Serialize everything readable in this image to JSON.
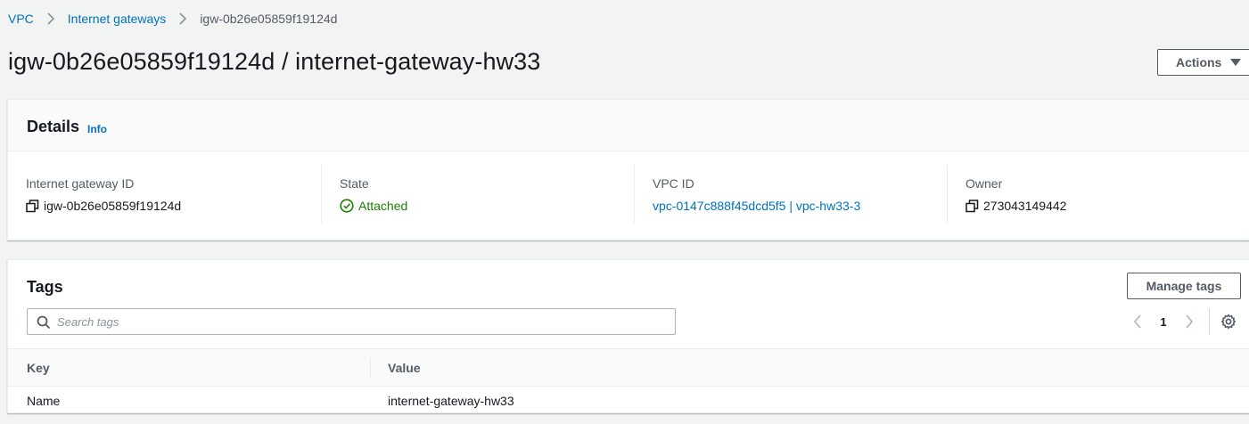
{
  "breadcrumb": {
    "items": [
      "VPC",
      "Internet gateways",
      "igw-0b26e05859f19124d"
    ]
  },
  "header": {
    "title": "igw-0b26e05859f19124d / internet-gateway-hw33",
    "actions_label": "Actions"
  },
  "details": {
    "title": "Details",
    "info_label": "Info",
    "fields": [
      {
        "label": "Internet gateway ID",
        "value": "igw-0b26e05859f19124d"
      },
      {
        "label": "State",
        "value": "Attached"
      },
      {
        "label": "VPC ID",
        "value": "vpc-0147c888f45dcd5f5 | vpc-hw33-3"
      },
      {
        "label": "Owner",
        "value": "273043149442"
      }
    ]
  },
  "tags": {
    "title": "Tags",
    "manage_label": "Manage tags",
    "search": {
      "placeholder": "Search tags",
      "value": ""
    },
    "pagination": {
      "current_page": "1"
    },
    "columns": [
      "Key",
      "Value"
    ],
    "rows": [
      {
        "key": "Name",
        "value": "internet-gateway-hw33"
      }
    ]
  },
  "colors": {
    "link": "#0073bb",
    "success": "#1d8102",
    "page_bg": "#f2f3f3",
    "text": "#16191f",
    "secondary_text": "#545b64"
  },
  "icons": {
    "breadcrumb_separator": "chevron-right-icon",
    "actions_caret": "caret-down-icon",
    "copy": "copy-icon",
    "state": "check-circle-icon",
    "search": "search-icon",
    "prev_page": "chevron-left-icon",
    "next_page": "chevron-right-icon",
    "settings": "gear-icon"
  }
}
